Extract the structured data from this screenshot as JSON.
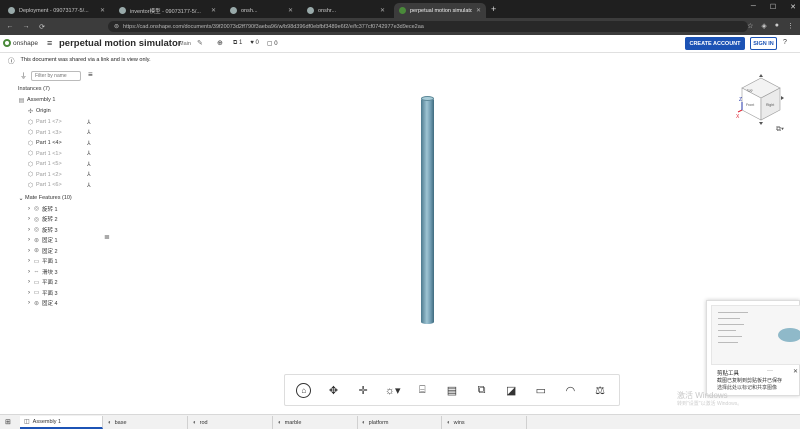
{
  "browser": {
    "tabs": [
      {
        "title": "Deployment - 09073177-5/...",
        "active": false
      },
      {
        "title": "inventor模型 - 09073177-5/...",
        "active": false
      },
      {
        "title": "onsh...",
        "active": false
      },
      {
        "title": "onshr...",
        "active": false
      },
      {
        "title": "perpetual motion simulator",
        "active": true
      }
    ],
    "url": "https://cad.onshape.com/documents/39f20073d2ff790f3aeba96/w/b98d396df0ebfbf3489e6f2/e/fc377cf0742977e3d9ece2aa"
  },
  "header": {
    "logo_text": "onshape",
    "doc_title": "perpetual motion simulator",
    "branch": "Main",
    "count_copies": "1",
    "count_likes": "0",
    "count_comments": "0",
    "create_account": "CREATE ACCOUNT",
    "sign_in": "SIGN IN"
  },
  "notice": {
    "text": "This document was shared via a link and is view only."
  },
  "left_panel": {
    "filter_placeholder": "Filter by name",
    "instances_header": "Instances (7)",
    "assembly": "Assembly 1",
    "origin": "Origin",
    "parts": [
      "Part 1 <7>",
      "Part 1 <3>",
      "Part 1 <4>",
      "Part 1 <1>",
      "Part 1 <5>",
      "Part 1 <2>",
      "Part 1 <6>"
    ],
    "mate_header": "Mate Features (10)",
    "mates": [
      "旋转 1",
      "旋转 2",
      "旋转 3",
      "固定 1",
      "固定 2",
      "平面 1",
      "滑块 3",
      "平面 2",
      "平面 3",
      "固定 4"
    ]
  },
  "view_cube": {
    "face_front": "Front",
    "face_top": "Top",
    "face_right": "Right",
    "axis_z": "Z",
    "axis_x": "X"
  },
  "toast": {
    "title": "剪贴工具",
    "more": "···",
    "close": "✕",
    "line1": "截图已复制到剪贴板并已保存",
    "line2": "选择此处以标记和共享图像"
  },
  "watermark": {
    "line1": "激活 Windows",
    "line2": "转到\"设置\"以激活 Windows。"
  },
  "doc_tabs": [
    "Assembly 1",
    "base",
    "rod",
    "marble",
    "platform",
    "wins"
  ]
}
